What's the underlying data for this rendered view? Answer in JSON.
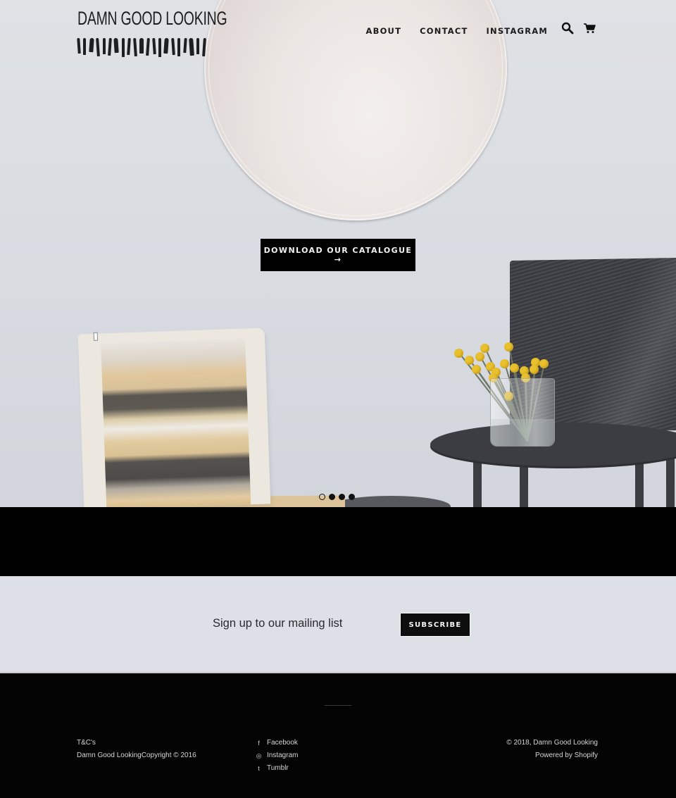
{
  "brand": {
    "name": "DAMN GOOD LOOKING"
  },
  "nav": {
    "items": [
      {
        "label": "ABOUT"
      },
      {
        "label": "CONTACT"
      },
      {
        "label": "INSTAGRAM"
      }
    ],
    "icons": {
      "search": "search-icon",
      "cart": "cart-icon"
    }
  },
  "hero": {
    "cta_label": "DOWNLOAD OUR CATALOGUE",
    "cta_arrow": "→",
    "slides_total": 4,
    "active_slide": 1
  },
  "newsletter": {
    "label": "Sign up to our mailing list",
    "button_label": "SUBSCRIBE"
  },
  "footer": {
    "left": [
      {
        "label": "T&C's"
      },
      {
        "label": "Damn Good LookingCopyright © 2016"
      }
    ],
    "social": [
      {
        "label": "Facebook",
        "icon": "facebook-icon",
        "glyph": "f"
      },
      {
        "label": "Instagram",
        "icon": "instagram-icon",
        "glyph": "◎"
      },
      {
        "label": "Tumblr",
        "icon": "tumblr-icon",
        "glyph": "t"
      }
    ],
    "right": [
      {
        "label": "© 2018, Damn Good Looking"
      },
      {
        "label": "Powered by Shopify"
      }
    ]
  },
  "colors": {
    "hero_bg": "#dcdfe4",
    "cta_bg": "#000000",
    "newsletter_bg": "#dde0e7",
    "footer_bg": "#030303",
    "flower": "#e8bf2c"
  }
}
